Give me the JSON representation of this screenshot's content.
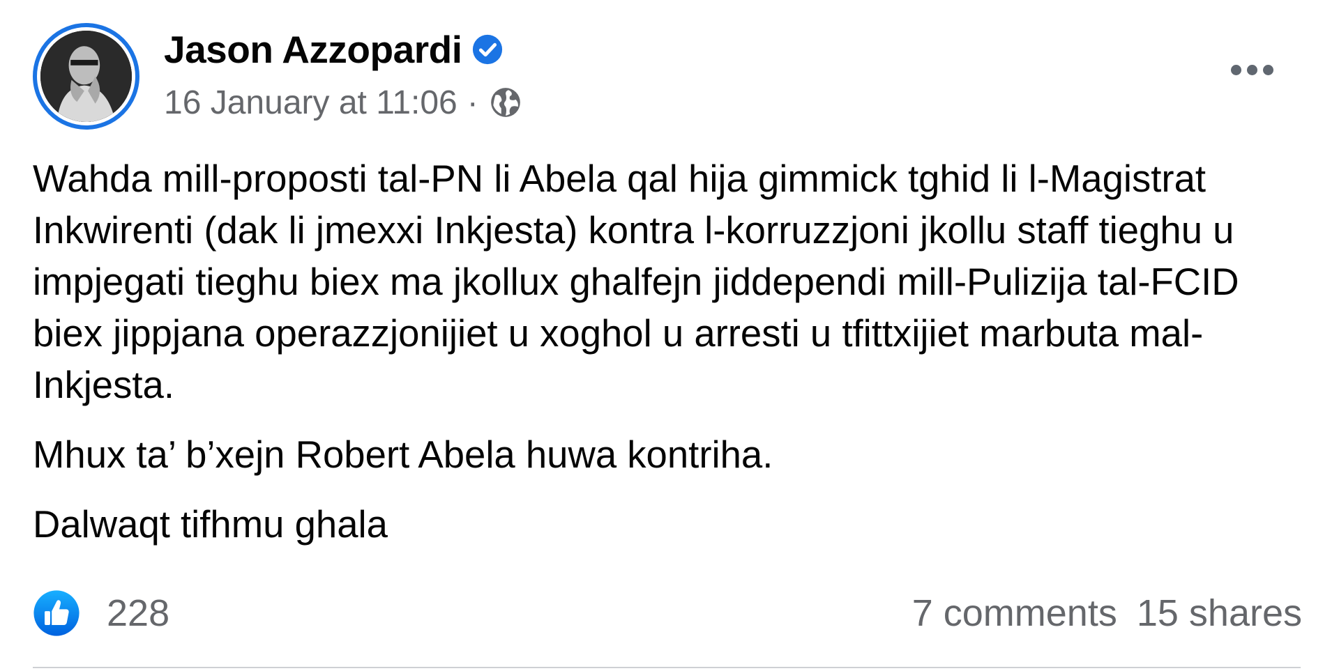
{
  "post": {
    "author": {
      "name": "Jason Azzopardi",
      "verified": true
    },
    "timestamp": "16 January at 11:06",
    "separator": "·",
    "audience_icon": "globe-icon",
    "more_icon": "more-options-icon",
    "paragraphs": [
      "Wahda mill-proposti tal-PN li Abela qal hija gimmick tghid li l-Magistrat Inkwirenti (dak li jmexxi Inkjesta) kontra l-korruzzjoni jkollu staff tieghu u impjegati tieghu biex ma jkollux ghalfejn jiddependi mill-Pulizija tal-FCID biex jippjana operazzjonijiet u xoghol u arresti u tfittxijiet marbuta mal-Inkjesta.",
      "Mhux ta’ b’xejn Robert Abela huwa kontriha.",
      "Dalwaqt tifhmu ghala"
    ],
    "reactions": {
      "icon": "like-icon",
      "count": "228"
    },
    "comments": "7 comments",
    "shares": "15 shares"
  },
  "colors": {
    "accent": "#1b74e4",
    "secondary_text": "#65676b",
    "primary_text": "#050505",
    "divider": "#ced0d4"
  }
}
